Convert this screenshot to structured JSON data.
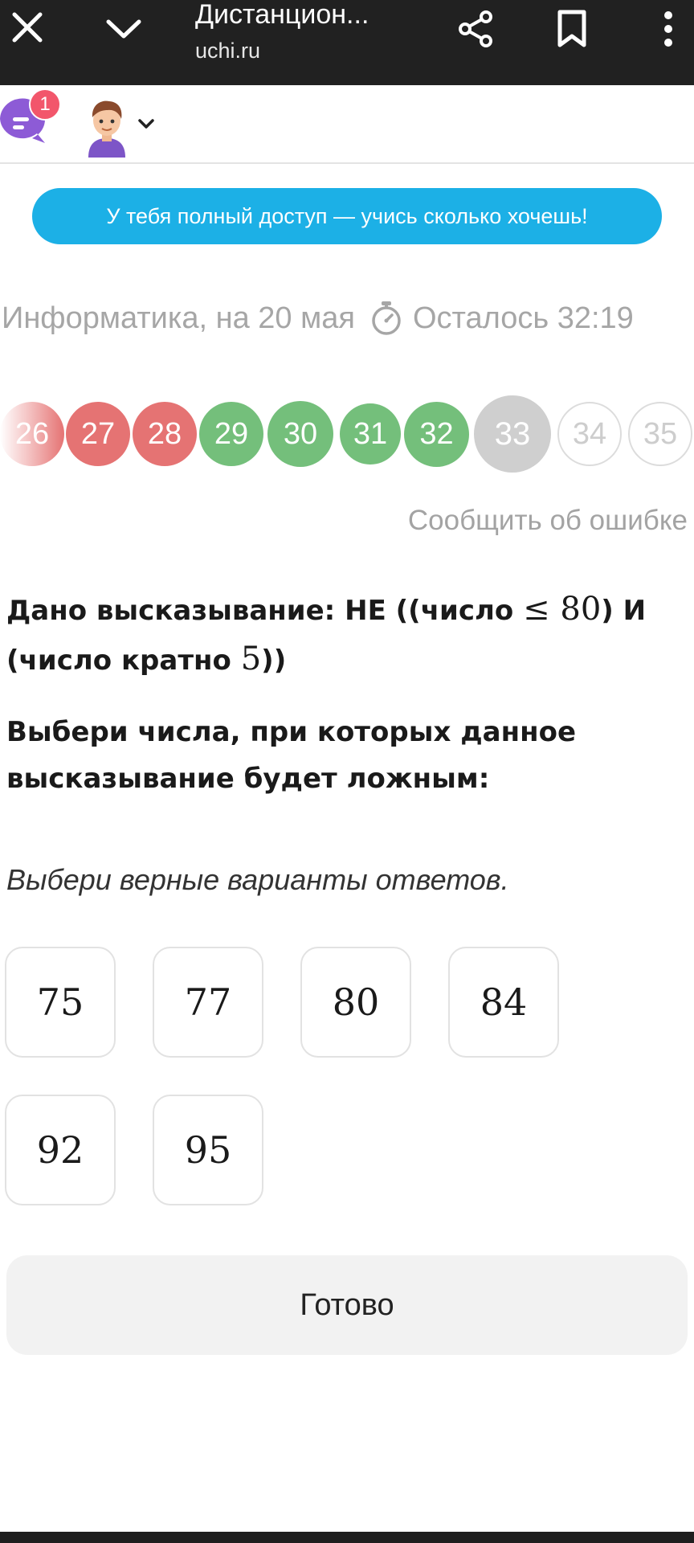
{
  "browser": {
    "title": "Дистанцион...",
    "url": "uchi.ru"
  },
  "header": {
    "notification_count": "1"
  },
  "banner": {
    "text": "У тебя полный доступ — учись сколько хочешь!"
  },
  "subject": {
    "label": "Информатика, на 20 мая",
    "timer": "Осталось 32:19"
  },
  "progress": [
    {
      "num": "26",
      "state": "wrong"
    },
    {
      "num": "27",
      "state": "wrong"
    },
    {
      "num": "28",
      "state": "wrong"
    },
    {
      "num": "29",
      "state": "correct"
    },
    {
      "num": "30",
      "state": "correct"
    },
    {
      "num": "31",
      "state": "correct"
    },
    {
      "num": "32",
      "state": "correct"
    },
    {
      "num": "33",
      "state": "current"
    },
    {
      "num": "34",
      "state": "pending"
    },
    {
      "num": "35",
      "state": "pending"
    }
  ],
  "report_link": "Сообщить об ошибке",
  "question": {
    "line1_a": "Дано высказывание: НЕ ((число ",
    "math1": "≤ 80",
    "line1_b": ") И",
    "line2_a": "(число кратно ",
    "math2": "5",
    "line2_b": "))",
    "prompt": "Выбери числа, при которых данное высказывание будет ложным:",
    "hint": "Выбери верные варианты ответов."
  },
  "options": [
    "75",
    "77",
    "80",
    "84",
    "92",
    "95"
  ],
  "done_label": "Готово",
  "colors": {
    "topbar": "#212121",
    "banner": "#1cb0e6",
    "wrong": "#e57373",
    "correct": "#74bf7b",
    "current": "#cfcfcf"
  }
}
